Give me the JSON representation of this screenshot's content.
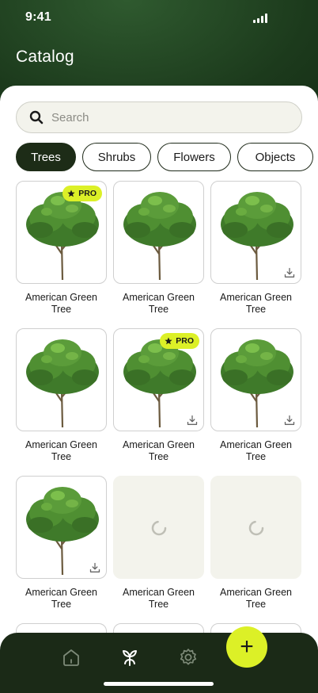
{
  "status_bar": {
    "time": "9:41"
  },
  "header": {
    "title": "Catalog"
  },
  "search": {
    "placeholder": "Search"
  },
  "categories": [
    {
      "label": "Trees",
      "active": true
    },
    {
      "label": "Shrubs",
      "active": false
    },
    {
      "label": "Flowers",
      "active": false
    },
    {
      "label": "Objects",
      "active": false
    }
  ],
  "badge_label": "PRO",
  "items": [
    {
      "label": "American Green Tree",
      "state": "pro"
    },
    {
      "label": "American Green Tree",
      "state": "plain"
    },
    {
      "label": "American Green Tree",
      "state": "download"
    },
    {
      "label": "American Green Tree",
      "state": "plain"
    },
    {
      "label": "American Green Tree",
      "state": "pro-download"
    },
    {
      "label": "American Green Tree",
      "state": "download"
    },
    {
      "label": "American Green Tree",
      "state": "download"
    },
    {
      "label": "American Green Tree",
      "state": "loading"
    },
    {
      "label": "American Green Tree",
      "state": "loading"
    }
  ],
  "nav": {
    "items": [
      "home-icon",
      "plant-icon",
      "settings-icon"
    ],
    "fab": "+"
  },
  "colors": {
    "accent": "#dcf027",
    "dark": "#1d2c17",
    "surface": "#f3f3ec"
  }
}
